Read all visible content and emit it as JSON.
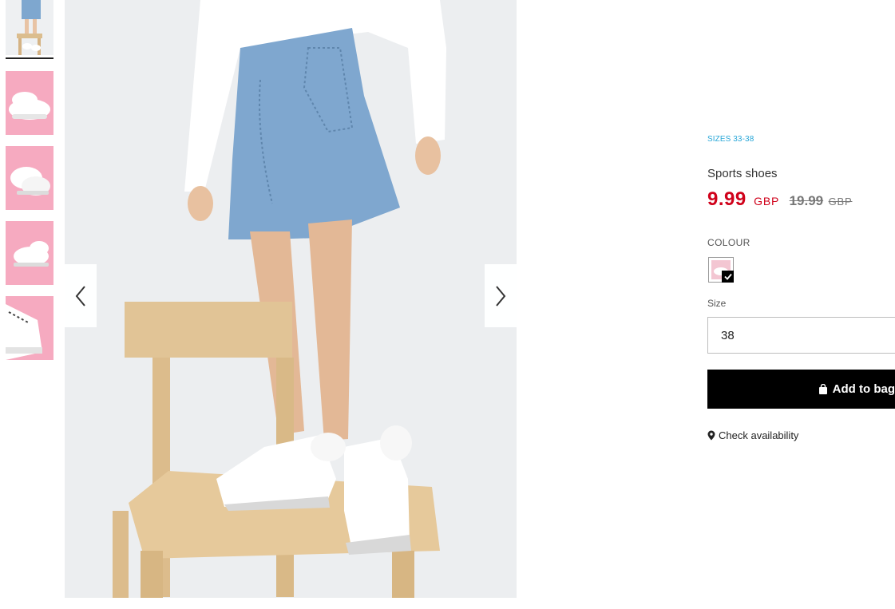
{
  "product": {
    "sizes_badge": "SIZES 33-38",
    "name": "Sports shoes",
    "price_current": "9.99",
    "price_current_currency": "GBP",
    "price_old": "19.99",
    "price_old_currency": "GBP"
  },
  "colour": {
    "label": "COLOUR",
    "selected": true
  },
  "size": {
    "label": "Size",
    "selected_value": "38"
  },
  "actions": {
    "add_to_bag": "Add to bag",
    "check_availability": "Check availability"
  },
  "icons": {
    "prev": "chevron-left-icon",
    "next": "chevron-right-icon",
    "bag": "shopping-bag-icon",
    "pin": "location-pin-icon",
    "check": "checkmark-icon"
  },
  "colors": {
    "price": "#d0021b",
    "badge": "#29a7d8",
    "thumb_bg": "#f4a9bf"
  }
}
